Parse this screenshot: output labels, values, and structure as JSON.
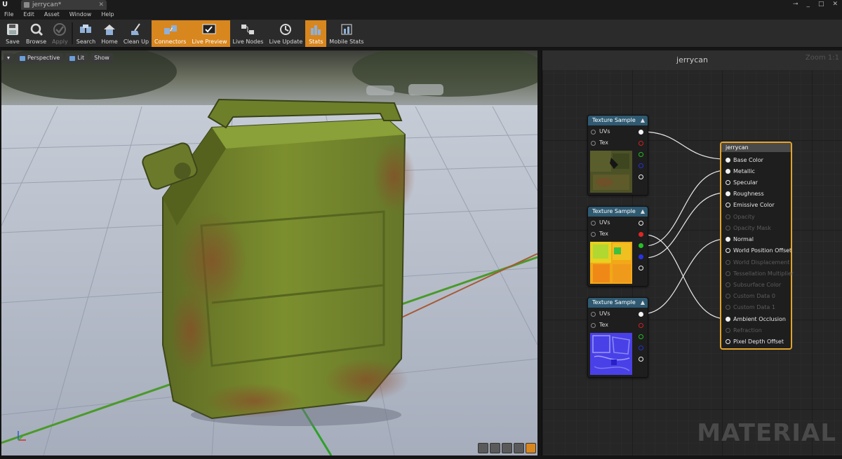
{
  "window": {
    "tab_title": "jerrycan*",
    "controls": [
      "⊸",
      "_",
      "□",
      "✕"
    ]
  },
  "menu": [
    "File",
    "Edit",
    "Asset",
    "Window",
    "Help"
  ],
  "toolbar": {
    "buttons": [
      {
        "label": "Save",
        "icon": "save-icon"
      },
      {
        "label": "Browse",
        "icon": "browse-icon"
      },
      {
        "label": "Apply",
        "icon": "apply-icon"
      },
      {
        "label": "Search",
        "icon": "search-icon"
      },
      {
        "label": "Home",
        "icon": "home-icon"
      },
      {
        "label": "Clean Up",
        "icon": "cleanup-icon"
      },
      {
        "label": "Connectors",
        "icon": "connectors-icon"
      },
      {
        "label": "Live Preview",
        "icon": "live-preview-icon"
      },
      {
        "label": "Live Nodes",
        "icon": "live-nodes-icon"
      },
      {
        "label": "Live Update",
        "icon": "live-update-icon"
      },
      {
        "label": "Stats",
        "icon": "stats-icon"
      },
      {
        "label": "Mobile Stats",
        "icon": "mobile-stats-icon"
      }
    ]
  },
  "viewport": {
    "view_mode": "Perspective",
    "lit_mode": "Lit",
    "show_label": "Show"
  },
  "graph": {
    "title": "jerrycan",
    "zoom": "Zoom 1:1",
    "watermark": "MATERIAL",
    "texture_node_title": "Texture Sample",
    "texture_node_inputs": [
      "UVs",
      "Tex"
    ],
    "result_node": {
      "title": "jerrycan",
      "pins": [
        {
          "label": "Base Color",
          "state": "connected"
        },
        {
          "label": "Metallic",
          "state": "connected"
        },
        {
          "label": "Specular",
          "state": "open"
        },
        {
          "label": "Roughness",
          "state": "connected"
        },
        {
          "label": "Emissive Color",
          "state": "open"
        },
        {
          "label": "Opacity",
          "state": "disabled"
        },
        {
          "label": "Opacity Mask",
          "state": "disabled"
        },
        {
          "label": "Normal",
          "state": "connected"
        },
        {
          "label": "World Position Offset",
          "state": "open"
        },
        {
          "label": "World Displacement",
          "state": "disabled"
        },
        {
          "label": "Tessellation Multiplier",
          "state": "disabled"
        },
        {
          "label": "Subsurface Color",
          "state": "disabled"
        },
        {
          "label": "Custom Data 0",
          "state": "disabled"
        },
        {
          "label": "Custom Data 1",
          "state": "disabled"
        },
        {
          "label": "Ambient Occlusion",
          "state": "connected"
        },
        {
          "label": "Refraction",
          "state": "disabled"
        },
        {
          "label": "Pixel Depth Offset",
          "state": "open"
        }
      ]
    }
  }
}
